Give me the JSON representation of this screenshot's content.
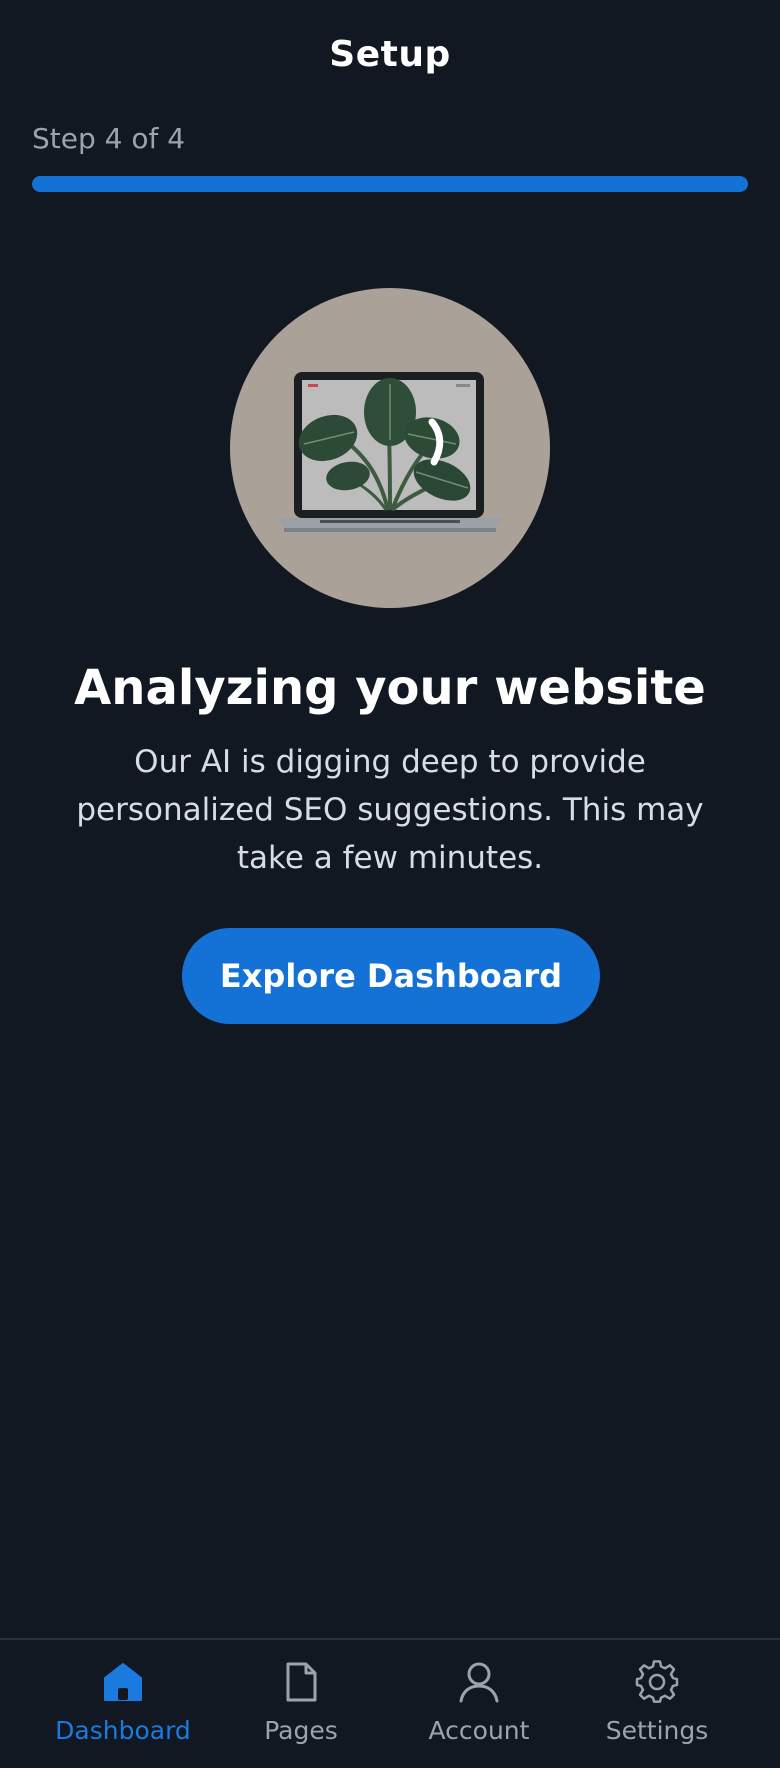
{
  "header": {
    "title": "Setup"
  },
  "progress": {
    "label": "Step 4 of 4",
    "current_step": 4,
    "total_steps": 4,
    "fraction": 1.0
  },
  "hero": {
    "image": "laptop-with-plant-illustration"
  },
  "content": {
    "headline": "Analyzing your website",
    "description": "Our AI is digging deep to provide personalized SEO suggestions. This may take a few minutes."
  },
  "cta": {
    "label": "Explore Dashboard"
  },
  "tabbar": {
    "items": [
      {
        "label": "Dashboard",
        "icon": "home-icon",
        "active": true
      },
      {
        "label": "Pages",
        "icon": "document-icon",
        "active": false
      },
      {
        "label": "Account",
        "icon": "user-icon",
        "active": false
      },
      {
        "label": "Settings",
        "icon": "gear-icon",
        "active": false
      }
    ]
  },
  "colors": {
    "background": "#111821",
    "accent": "#1472d6",
    "muted_text": "#9aa4b0",
    "hero_circle": "#aaa199"
  }
}
